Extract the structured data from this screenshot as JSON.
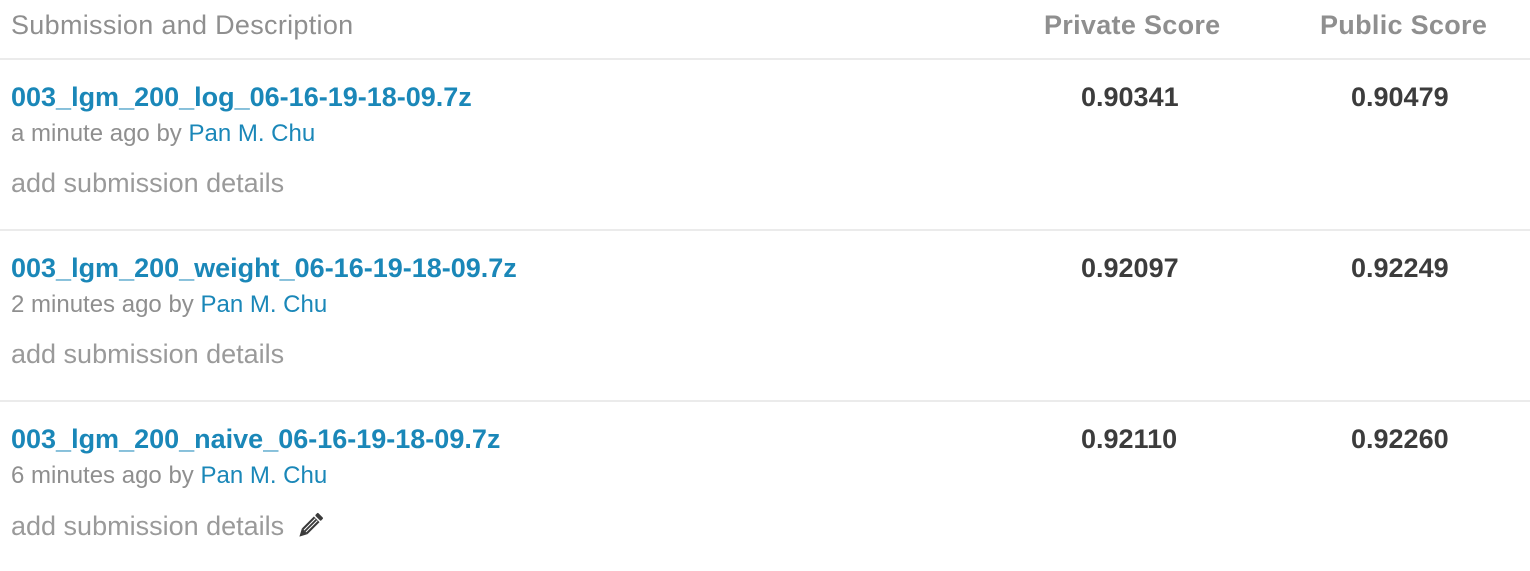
{
  "header": {
    "description_label": "Submission and Description",
    "private_label": "Private Score",
    "public_label": "Public Score"
  },
  "submissions": [
    {
      "name": "003_lgm_200_log_06-16-19-18-09.7z",
      "time": "a minute ago",
      "by": "by",
      "author": "Pan M. Chu",
      "details": "add submission details",
      "private_score": "0.90341",
      "public_score": "0.90479"
    },
    {
      "name": "003_lgm_200_weight_06-16-19-18-09.7z",
      "time": "2 minutes ago",
      "by": "by",
      "author": "Pan M. Chu",
      "details": "add submission details",
      "private_score": "0.92097",
      "public_score": "0.92249"
    },
    {
      "name": "003_lgm_200_naive_06-16-19-18-09.7z",
      "time": "6 minutes ago",
      "by": "by",
      "author": "Pan M. Chu",
      "details": "add submission details",
      "private_score": "0.92110",
      "public_score": "0.92260"
    }
  ],
  "icons": {
    "edit": "pencil-icon"
  },
  "colors": {
    "link": "#1a87b8",
    "muted": "#8f8f8f",
    "score": "#3c3c3c",
    "divider": "#ebebeb"
  }
}
